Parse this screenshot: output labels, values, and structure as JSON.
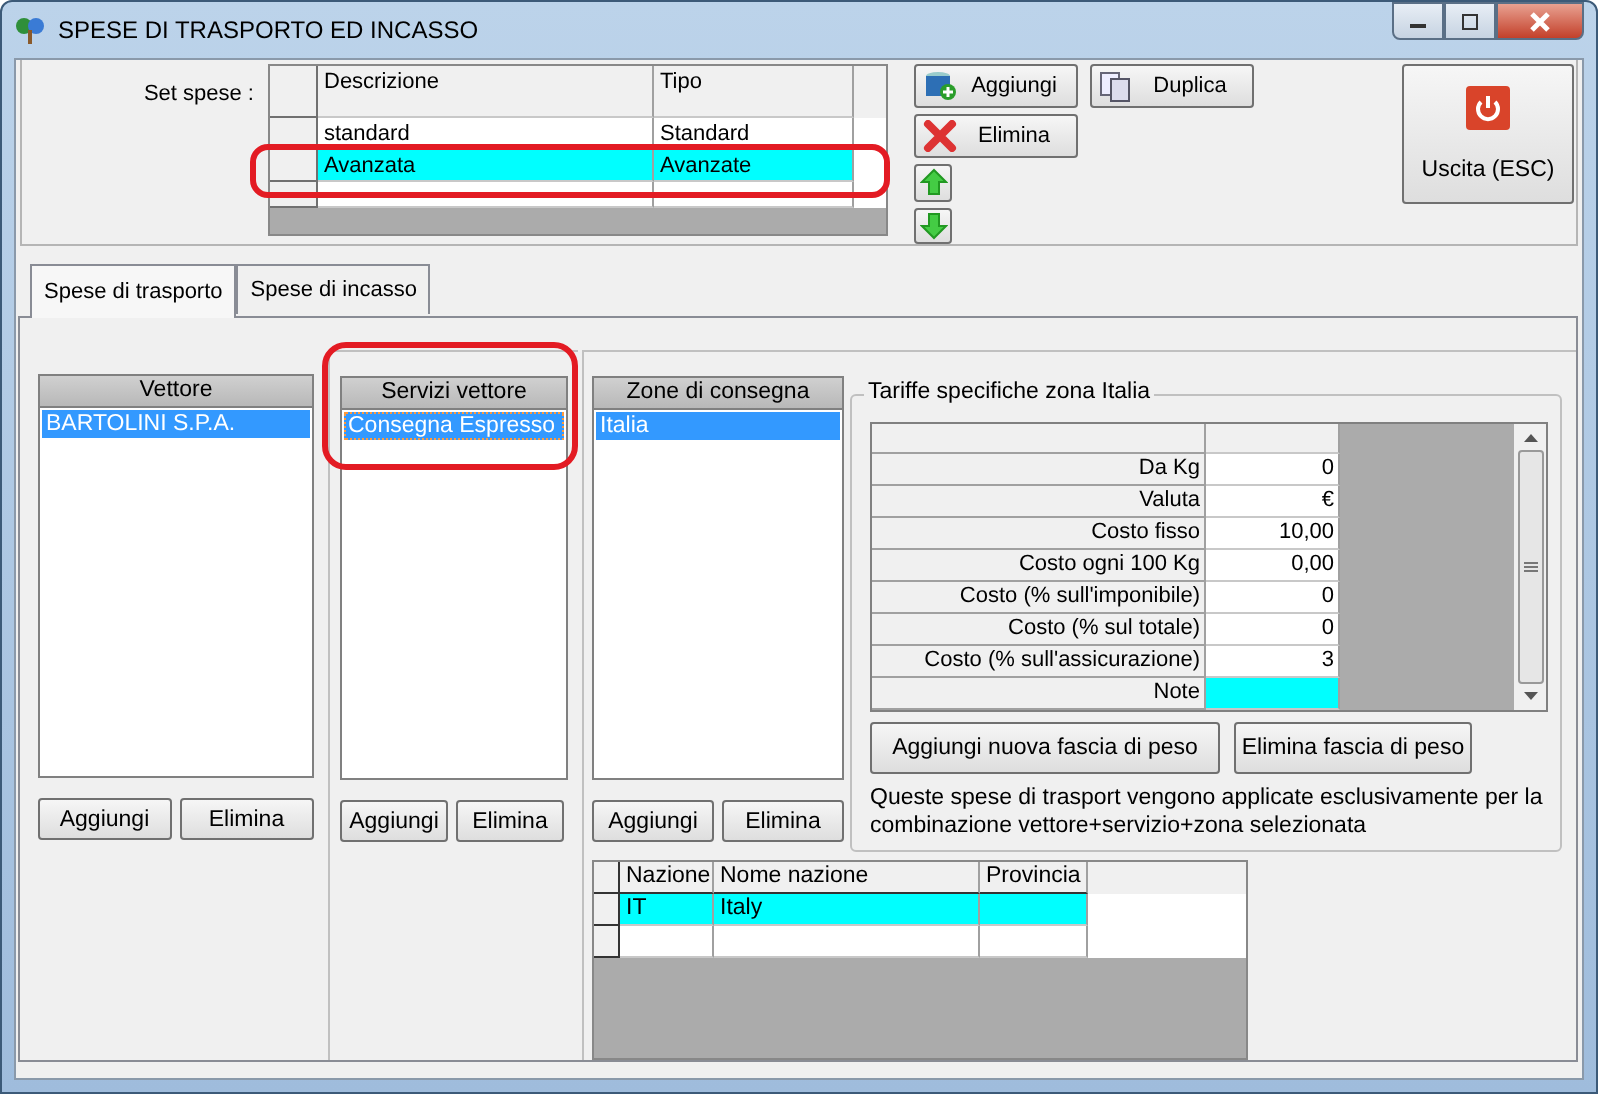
{
  "window": {
    "title": "SPESE DI TRASPORTO ED INCASSO"
  },
  "set_spese": {
    "label": "Set spese :",
    "columns": [
      "Descrizione",
      "Tipo"
    ],
    "rows": [
      {
        "cells": [
          "standard",
          "Standard"
        ],
        "selected": false
      },
      {
        "cells": [
          "Avanzata",
          "Avanzate"
        ],
        "selected": true
      }
    ]
  },
  "top_buttons": [
    {
      "label": "Aggiungi",
      "kind": "add"
    },
    {
      "label": "Duplica",
      "kind": "duplicate"
    },
    {
      "label": "Elimina",
      "kind": "delete"
    }
  ],
  "exit_button": {
    "label": "Uscita (ESC)"
  },
  "tabs": [
    {
      "label": "Spese di trasporto",
      "selected": true
    },
    {
      "label": "Spese di incasso",
      "selected": false
    }
  ],
  "lists": [
    {
      "title": "Vettore",
      "items": [
        {
          "label": "BARTOLINI S.P.A.",
          "selected": true
        }
      ],
      "buttons": [
        "Aggiungi",
        "Elimina"
      ]
    },
    {
      "title": "Servizi vettore",
      "items": [
        {
          "label": "Consegna Espresso",
          "selected": true
        }
      ],
      "buttons": [
        "Aggiungi",
        "Elimina"
      ]
    },
    {
      "title": "Zone di consegna",
      "items": [
        {
          "label": "Italia",
          "selected": true
        }
      ],
      "buttons": [
        "Aggiungi",
        "Elimina"
      ]
    }
  ],
  "tariffe": {
    "title": "Tariffe specifiche zona Italia",
    "rows": [
      {
        "label": "Da Kg",
        "value": "0",
        "selected": false
      },
      {
        "label": "Valuta",
        "value": "€",
        "selected": false
      },
      {
        "label": "Costo fisso",
        "value": "10,00",
        "selected": false
      },
      {
        "label": "Costo ogni 100 Kg",
        "value": "0,00",
        "selected": false
      },
      {
        "label": "Costo (% sull'imponibile)",
        "value": "0",
        "selected": false
      },
      {
        "label": "Costo (% sul totale)",
        "value": "0",
        "selected": false
      },
      {
        "label": "Costo (% sull'assicurazione)",
        "value": "3",
        "selected": false
      },
      {
        "label": "Note",
        "selected": true
      }
    ],
    "buttons": [
      "Aggiungi nuova fascia di peso",
      "Elimina fascia di peso"
    ],
    "note": "Queste spese di trasport vengono applicate esclusivamente per la combinazione vettore+servizio+zona selezionata"
  },
  "nazioni": {
    "columns": [
      "Nazione",
      "Nome nazione",
      "Provincia"
    ],
    "rows": [
      {
        "nazione": "IT",
        "nome": "Italy",
        "selected": true
      }
    ]
  }
}
